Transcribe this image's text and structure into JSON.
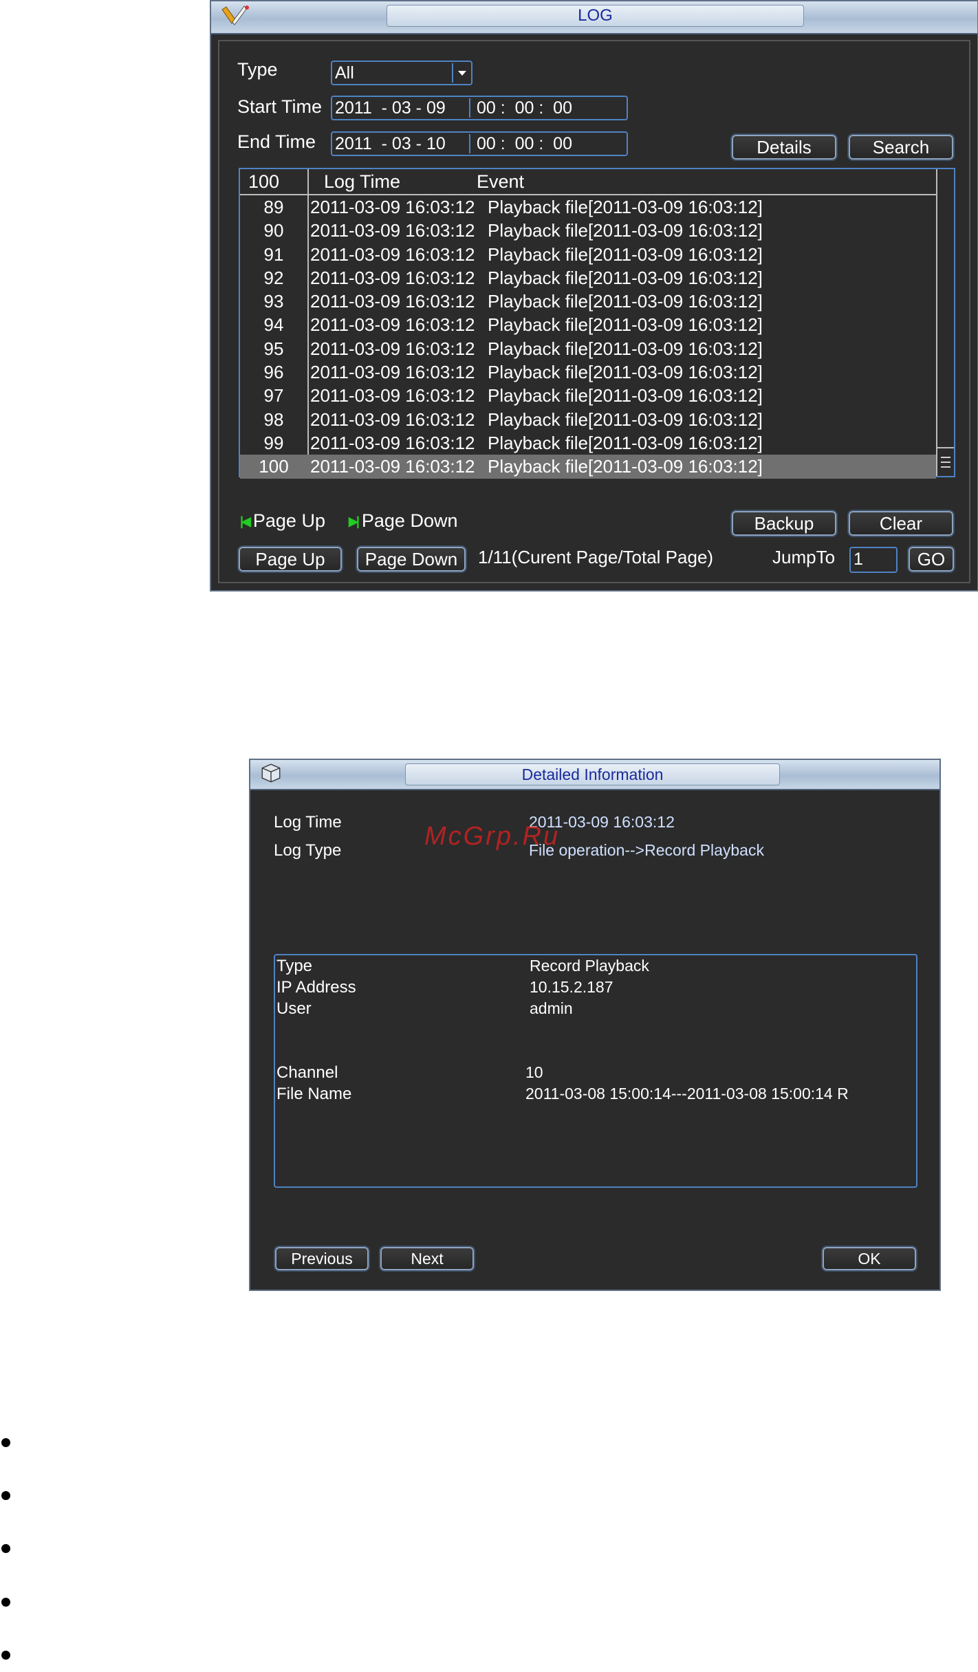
{
  "log_window": {
    "title": "LOG",
    "type_label": "Type",
    "type_value": "All",
    "start_label": "Start Time",
    "start_date": "2011  - 03 - 09",
    "start_time": "00 :  00 :  00",
    "end_label": "End Time",
    "end_date": "2011  - 03 - 10",
    "end_time": "00 :  00 :  00",
    "details_button": "Details",
    "search_button": "Search",
    "table": {
      "headers": [
        "100",
        "Log Time",
        "Event"
      ],
      "rows": [
        {
          "num": "89",
          "time": "2011-03-09 16:03:12",
          "event": "Playback file[2011-03-09 16:03:12]"
        },
        {
          "num": "90",
          "time": "2011-03-09 16:03:12",
          "event": "Playback file[2011-03-09 16:03:12]"
        },
        {
          "num": "91",
          "time": "2011-03-09 16:03:12",
          "event": "Playback file[2011-03-09 16:03:12]"
        },
        {
          "num": "92",
          "time": "2011-03-09 16:03:12",
          "event": "Playback file[2011-03-09 16:03:12]"
        },
        {
          "num": "93",
          "time": "2011-03-09 16:03:12",
          "event": "Playback file[2011-03-09 16:03:12]"
        },
        {
          "num": "94",
          "time": "2011-03-09 16:03:12",
          "event": "Playback file[2011-03-09 16:03:12]"
        },
        {
          "num": "95",
          "time": "2011-03-09 16:03:12",
          "event": "Playback file[2011-03-09 16:03:12]"
        },
        {
          "num": "96",
          "time": "2011-03-09 16:03:12",
          "event": "Playback file[2011-03-09 16:03:12]"
        },
        {
          "num": "97",
          "time": "2011-03-09 16:03:12",
          "event": "Playback file[2011-03-09 16:03:12]"
        },
        {
          "num": "98",
          "time": "2011-03-09 16:03:12",
          "event": "Playback file[2011-03-09 16:03:12]"
        },
        {
          "num": "99",
          "time": "2011-03-09 16:03:12",
          "event": "Playback file[2011-03-09 16:03:12]"
        },
        {
          "num": "100",
          "time": "2011-03-09 16:03:12",
          "event": "Playback file[2011-03-09 16:03:12]"
        }
      ],
      "selected_num": "100"
    },
    "hint_page_up": "Page Up",
    "hint_page_down": "Page Down",
    "backup_button": "Backup",
    "clear_button": "Clear",
    "page_up_button": "Page Up",
    "page_down_button": "Page Down",
    "page_info": "1/11(Curent Page/Total Page)",
    "jump_label": "JumpTo",
    "jump_value": "1",
    "go_button": "GO"
  },
  "detail_window": {
    "title": "Detailed Information",
    "log_time_label": "Log Time",
    "log_time_value": "2011-03-09 16:03:12",
    "log_type_label": "Log Type",
    "log_type_value": "File operation-->Record Playback",
    "type_label": "Type",
    "type_value": "Record Playback",
    "ip_label": "IP Address",
    "ip_value": "10.15.2.187",
    "user_label": "User",
    "user_value": "admin",
    "channel_label": "Channel",
    "channel_value": "10",
    "file_label": "File Name",
    "file_value": "2011-03-08 15:00:14---2011-03-08 15:00:14 R",
    "previous_button": "Previous",
    "next_button": "Next",
    "ok_button": "OK"
  },
  "watermark": "McGrp.Ru",
  "colors": {
    "panel_bg": "#2b2b2b",
    "field_border": "#4f83c4",
    "title_text": "#1a2a9c",
    "nav_icon": "#22cc22",
    "watermark": "#e02020"
  }
}
